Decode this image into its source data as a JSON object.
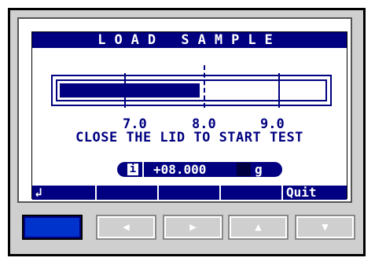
{
  "screen": {
    "title": "LOAD SAMPLE",
    "gauge": {
      "fill_fraction": 0.53
    },
    "scale_labels": [
      "7.0",
      "8.0",
      "9.0"
    ],
    "message": "CLOSE THE LID TO START TEST",
    "readout": {
      "info_glyph": "i",
      "value": "+08.000",
      "unit": "g"
    },
    "softkeys": [
      "↲",
      "",
      "",
      "",
      "Quit"
    ]
  },
  "hardware_buttons": [
    {
      "name": "blank-button",
      "glyph": ""
    },
    {
      "name": "left-arrow-button",
      "glyph": "◀"
    },
    {
      "name": "right-arrow-button",
      "glyph": "▶"
    },
    {
      "name": "up-arrow-button",
      "glyph": "▲"
    },
    {
      "name": "down-arrow-button",
      "glyph": "▼"
    }
  ],
  "colors": {
    "display_accent": "#000080",
    "panel": "#cfcfcf",
    "active_button": "#0033cc"
  }
}
